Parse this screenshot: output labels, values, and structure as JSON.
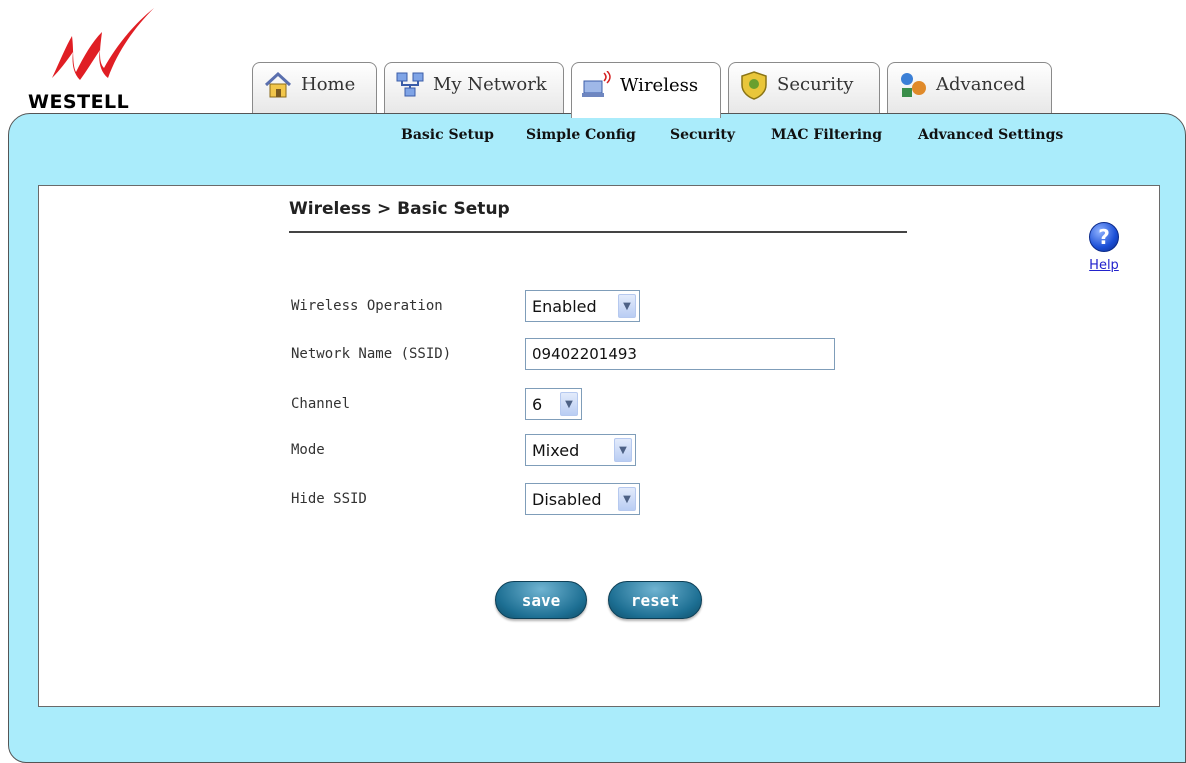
{
  "brand": {
    "name": "WESTELL",
    "logo_color": "#e01e24"
  },
  "tabs": [
    {
      "label": "Home",
      "icon": "home-icon"
    },
    {
      "label": "My Network",
      "icon": "network-icon"
    },
    {
      "label": "Wireless",
      "icon": "wireless-icon",
      "active": true
    },
    {
      "label": "Security",
      "icon": "shield-icon"
    },
    {
      "label": "Advanced",
      "icon": "advanced-icon"
    }
  ],
  "subnav": [
    "Basic Setup",
    "Simple Config",
    "Security",
    "MAC Filtering",
    "Advanced Settings"
  ],
  "page": {
    "title": "Wireless > Basic Setup"
  },
  "help": {
    "label": "Help",
    "icon": "help-icon"
  },
  "form": {
    "wireless_operation": {
      "label": "Wireless Operation",
      "value": "Enabled"
    },
    "ssid": {
      "label": "Network Name (SSID)",
      "value": "09402201493"
    },
    "channel": {
      "label": "Channel",
      "value": "6"
    },
    "mode": {
      "label": "Mode",
      "value": "Mixed"
    },
    "hide_ssid": {
      "label": "Hide SSID",
      "value": "Disabled"
    }
  },
  "buttons": {
    "save": "save",
    "reset": "reset"
  },
  "colors": {
    "frame": "#aaecfb",
    "button": "#1d6f93",
    "link": "#2222cc"
  }
}
